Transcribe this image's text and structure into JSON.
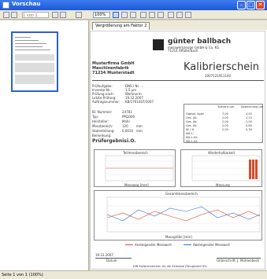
{
  "window": {
    "title": "Vorschau",
    "min": "–",
    "max": "□",
    "close": "✕"
  },
  "toolbar": {
    "page_input": "1 von 1",
    "zoom": "100%"
  },
  "tab": {
    "label": "Vergrößerung am Faktor 2"
  },
  "document": {
    "company_name": "günter ballbach",
    "company_sub1": "messwerkzeuge GmbH & Co. KG",
    "company_sub2": "71214 Affalterbach",
    "customer1": "Musterfirma GmbH",
    "customer2": "Maschinenfabrik",
    "customer3": "71234 Musterstadt",
    "heading": "Kalibrierschein",
    "cert_no": "2007121911140",
    "fields": [
      {
        "label": "Prüfaufgabe:",
        "value": "DNS / Nr. ..."
      },
      {
        "label": "Inventar-Nr.:",
        "value": "1,5 µm"
      },
      {
        "label": "Prüfung nach:",
        "value": "Werknorm"
      },
      {
        "label": "Letzte Prüfung:",
        "value": "19.12.2007"
      },
      {
        "label": "Auftragsnummer:",
        "value": "KB/1701407/2007"
      }
    ],
    "fields2": [
      {
        "label": "ID. Nummer:",
        "value": "24781"
      },
      {
        "label": "Typ:",
        "value": "PM1000"
      },
      {
        "label": "Hersteller:",
        "value": "Mahr"
      },
      {
        "label": "Messbereich:",
        "value": "120",
        "unit": "mm"
      },
      {
        "label": "Skalenteilung:",
        "value": "0,0010",
        "unit": "mm"
      },
      {
        "label": "Bemerkung:",
        "value": ""
      },
      {
        "label": "Prüfergebnis:",
        "value": "i.O."
      }
    ],
    "table_headers": [
      "Toleranz µm",
      "Abweichung µm"
    ],
    "table_rows": [
      {
        "label": "Ggesal. Spiel",
        "a": "7,00",
        "b": "4,00"
      },
      {
        "label": "Ges. Ab.",
        "a": "2,00",
        "b": "2,20"
      },
      {
        "label": "Ges. Ab.",
        "a": "2,00",
        "b": "2,00"
      },
      {
        "label": "Ges. Ab.",
        "a": "2,00",
        "b": "0,80"
      },
      {
        "label": "W. / H",
        "a": "2,00",
        "b": "0,30"
      },
      {
        "label": "MA.1:",
        "a": "",
        "b": ""
      },
      {
        "label": "MA.1.02:",
        "a": "",
        "b": ""
      },
      {
        "label": "MA.1.03:",
        "a": "",
        "b": ""
      }
    ],
    "chart1_title": "Teilmessbereich",
    "chart2_title": "Wiederholbarkeit",
    "chart3_title": "Gesamtmessbereich",
    "chart1_xlabel": "Messweg [mm]",
    "chart2_xlabel": "Messung",
    "chart3_xlabel": "Messgröße [mm]",
    "legend1": "Ansteigender Messwert",
    "legend2": "Absteigender Messwert",
    "date": "19.12.2007",
    "date_label": "Datum",
    "signature_label": "Unterschrift: J. Mühlenbeck",
    "footer": "DIN Kalibrierzeichen für die Zeitskala (Fahrgestell XY)"
  },
  "status": {
    "text": "Seite 1 von 1 (100%)"
  }
}
